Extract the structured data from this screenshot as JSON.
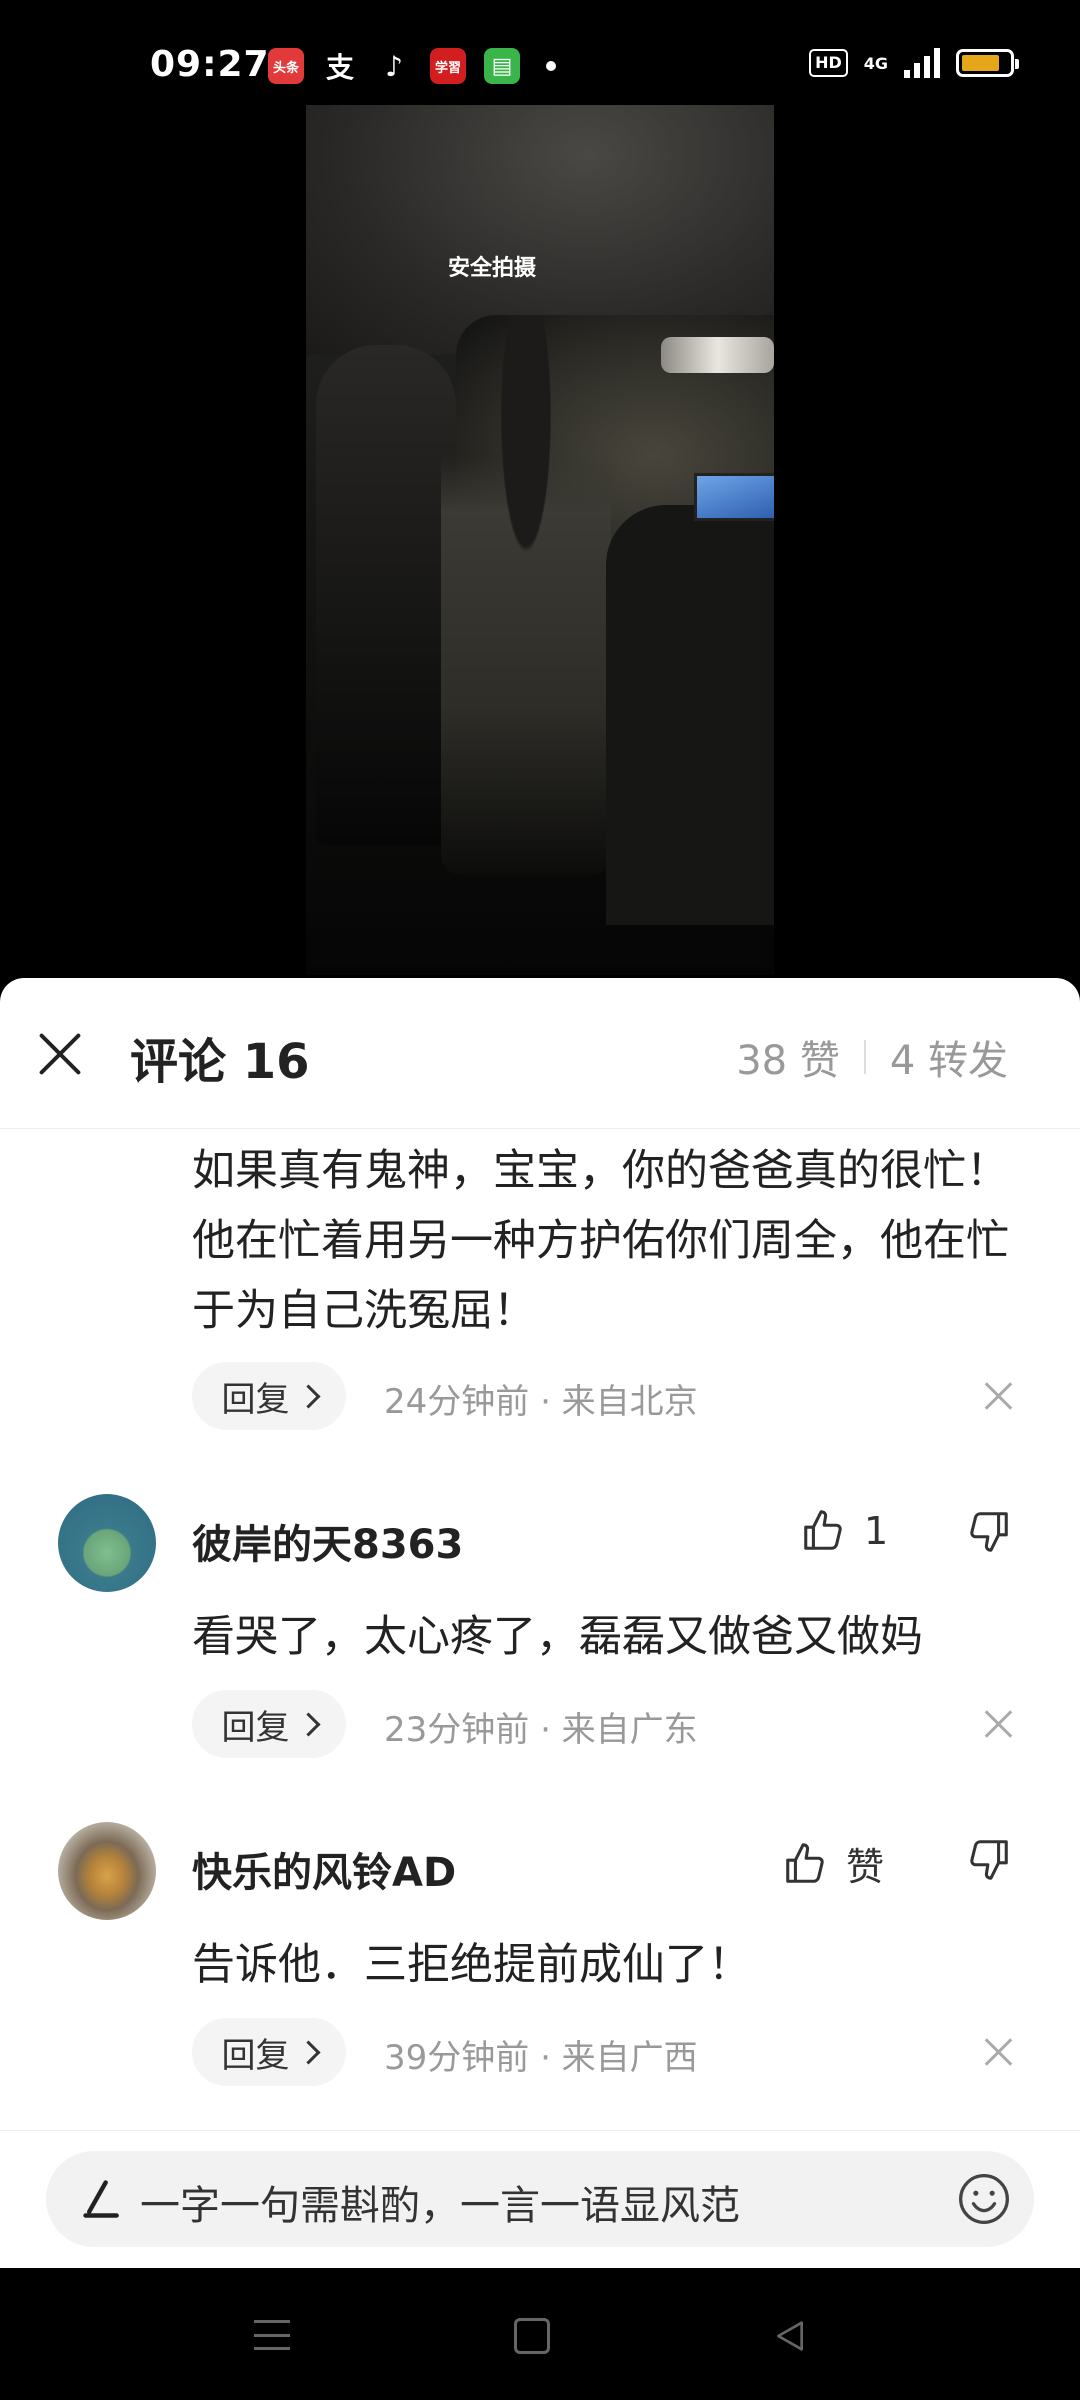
{
  "status_bar": {
    "time": "09:27",
    "app_icons": [
      {
        "name": "toutiao-icon",
        "label": "头条",
        "color": "#e23a3a"
      },
      {
        "name": "alipay-icon",
        "label": "支",
        "color": "#000000"
      },
      {
        "name": "tiktok-icon",
        "label": "♪",
        "color": "#000000"
      },
      {
        "name": "xuexi-icon",
        "label": "学習",
        "color": "#d21e1e"
      },
      {
        "name": "messages-icon",
        "label": "▤",
        "color": "#3ab54a"
      }
    ],
    "hd": "HD",
    "network": "4G",
    "battery_level": 0.8
  },
  "video": {
    "watermark": "安全拍摄"
  },
  "comments_sheet": {
    "title": "评论 16",
    "likes": "38 赞",
    "shares": "4 转发",
    "comments": [
      {
        "text": "如果真有鬼神，宝宝，你的爸爸真的很忙！他在忙着用另一种方护佑你们周全，他在忙于为自己洗冤屈！",
        "reply_label": "回复",
        "meta": "24分钟前 · 来自北京"
      },
      {
        "username": "彼岸的天8363",
        "like_label": "1",
        "text": "看哭了，太心疼了，磊磊又做爸又做妈",
        "reply_label": "回复",
        "meta": "23分钟前 · 来自广东"
      },
      {
        "username": "快乐的风铃AD",
        "like_label": "赞",
        "text": "告诉他．三拒绝提前成仙了！",
        "reply_label": "回复",
        "meta": "39分钟前 · 来自广西"
      }
    ]
  },
  "input": {
    "placeholder": "一字一句需斟酌，一言一语显风范"
  },
  "nav": {
    "items": [
      "menu",
      "home",
      "back"
    ]
  }
}
